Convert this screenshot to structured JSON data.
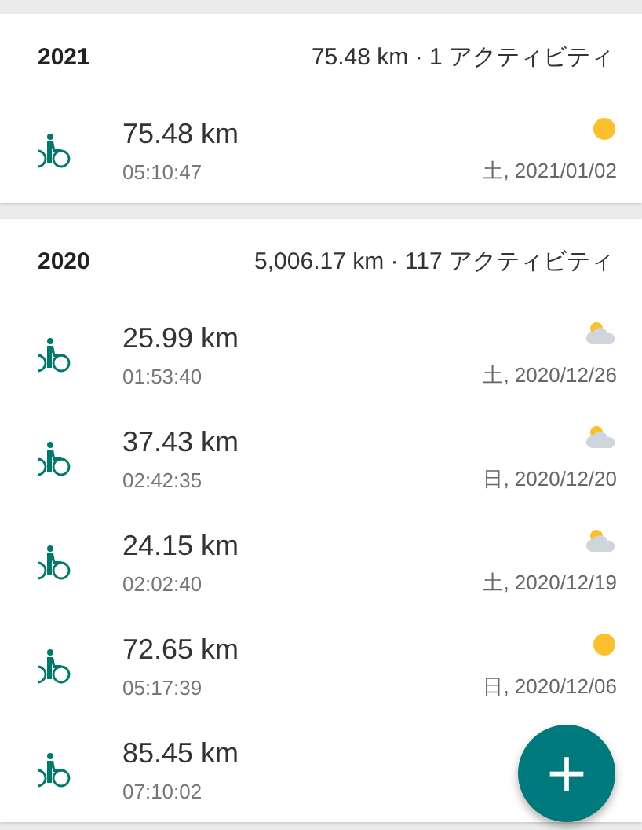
{
  "years": [
    {
      "year": "2021",
      "summary": "75.48 km · 1 アクティビティ",
      "activities": [
        {
          "distance": "75.48 km",
          "duration": "05:10:47",
          "date": "土, 2021/01/02",
          "weather": {
            "kind": "sunny"
          }
        }
      ]
    },
    {
      "year": "2020",
      "summary": "5,006.17 km · 117 アクティビティ",
      "activities": [
        {
          "distance": "25.99 km",
          "duration": "01:53:40",
          "date": "土, 2020/12/26",
          "weather": {
            "kind": "cloudy"
          }
        },
        {
          "distance": "37.43 km",
          "duration": "02:42:35",
          "date": "日, 2020/12/20",
          "weather": {
            "kind": "cloudy"
          }
        },
        {
          "distance": "24.15 km",
          "duration": "02:02:40",
          "date": "土, 2020/12/19",
          "weather": {
            "kind": "cloudy"
          }
        },
        {
          "distance": "72.65 km",
          "duration": "05:17:39",
          "date": "日, 2020/12/06",
          "weather": {
            "kind": "sunny"
          }
        },
        {
          "distance": "85.45 km",
          "duration": "07:10:02"
        }
      ]
    }
  ],
  "fab": {
    "label": "+"
  }
}
